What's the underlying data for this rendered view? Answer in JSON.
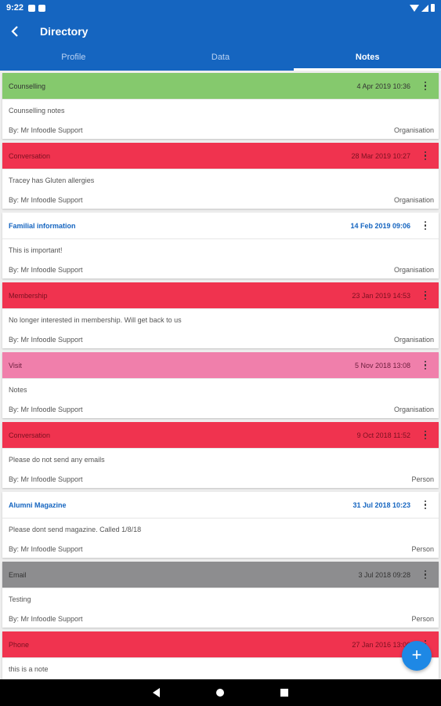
{
  "status_bar": {
    "time": "9:22"
  },
  "app_bar": {
    "title": "Directory"
  },
  "tabs": [
    {
      "label": "Profile",
      "active": false
    },
    {
      "label": "Data",
      "active": false
    },
    {
      "label": "Notes",
      "active": true
    }
  ],
  "notes": [
    {
      "type": "Counselling",
      "date": "4 Apr 2019 10:36",
      "body": "Counselling notes",
      "author": "By: Mr Infoodle Support",
      "scope": "Organisation",
      "color": "#85c96d",
      "text_color": "#333333"
    },
    {
      "type": "Conversation",
      "date": "28 Mar 2019 10:27",
      "body": "Tracey has Gluten allergies",
      "author": "By: Mr Infoodle Support",
      "scope": "Organisation",
      "color": "#f0334f",
      "text_color": "#7a1020"
    },
    {
      "type": "Familial information",
      "date": "14 Feb 2019 09:06",
      "body": "This is important!",
      "author": "By: Mr Infoodle Support",
      "scope": "Organisation",
      "color": "#ffffff",
      "text_color": "#1565c0"
    },
    {
      "type": "Membership",
      "date": "23 Jan 2019 14:53",
      "body": "No longer interested in membership. Will get back to us",
      "author": "By: Mr Infoodle Support",
      "scope": "Organisation",
      "color": "#f0334f",
      "text_color": "#7a1020"
    },
    {
      "type": "Visit",
      "date": "5 Nov 2018 13:08",
      "body": "Notes",
      "author": "By: Mr Infoodle Support",
      "scope": "Organisation",
      "color": "#f07fab",
      "text_color": "#6b1d3c"
    },
    {
      "type": "Conversation",
      "date": "9 Oct 2018 11:52",
      "body": "Please do not send any emails",
      "author": "By: Mr Infoodle Support",
      "scope": "Person",
      "color": "#f0334f",
      "text_color": "#7a1020"
    },
    {
      "type": "Alumni Magazine",
      "date": "31 Jul 2018 10:23",
      "body": "Please dont send magazine. Called 1/8/18",
      "author": "By: Mr Infoodle Support",
      "scope": "Person",
      "color": "#ffffff",
      "text_color": "#1565c0"
    },
    {
      "type": "Email",
      "date": "3 Jul 2018 09:28",
      "body": "Testing",
      "author": "By: Mr Infoodle Support",
      "scope": "Person",
      "color": "#8d8d8f",
      "text_color": "#333333"
    },
    {
      "type": "Phone",
      "date": "27 Jan 2016 13:06",
      "body": "this is a note",
      "author": "",
      "scope": "",
      "color": "#f0334f",
      "text_color": "#7a1020"
    }
  ],
  "fab": {
    "label": "+"
  }
}
